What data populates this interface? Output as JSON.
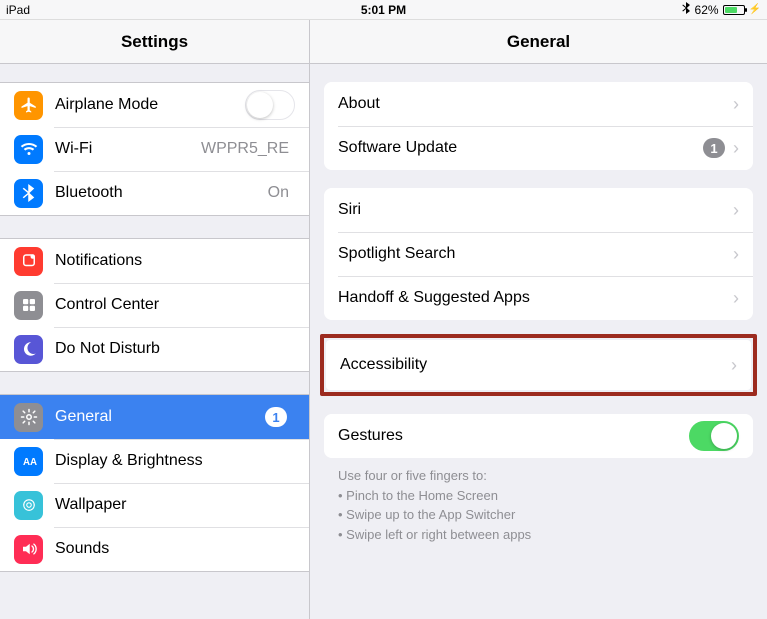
{
  "statusbar": {
    "device": "iPad",
    "time": "5:01 PM",
    "battery": "62%"
  },
  "sidebar": {
    "title": "Settings",
    "groups": [
      [
        {
          "key": "airplane",
          "label": "Airplane Mode",
          "toggle": "off"
        },
        {
          "key": "wifi",
          "label": "Wi-Fi",
          "value": "WPPR5_RE"
        },
        {
          "key": "bluetooth",
          "label": "Bluetooth",
          "value": "On"
        }
      ],
      [
        {
          "key": "notifications",
          "label": "Notifications"
        },
        {
          "key": "controlcenter",
          "label": "Control Center"
        },
        {
          "key": "dnd",
          "label": "Do Not Disturb"
        }
      ],
      [
        {
          "key": "general",
          "label": "General",
          "badge": "1",
          "selected": true
        },
        {
          "key": "display",
          "label": "Display & Brightness"
        },
        {
          "key": "wallpaper",
          "label": "Wallpaper"
        },
        {
          "key": "sounds",
          "label": "Sounds"
        }
      ]
    ]
  },
  "detail": {
    "title": "General",
    "groups": {
      "g1": [
        {
          "label": "About"
        },
        {
          "label": "Software Update",
          "badge": "1"
        }
      ],
      "g2": [
        {
          "label": "Siri"
        },
        {
          "label": "Spotlight Search"
        },
        {
          "label": "Handoff & Suggested Apps"
        }
      ],
      "accessibility": {
        "label": "Accessibility"
      },
      "g4": [
        {
          "label": "Gestures",
          "toggle": "on"
        }
      ],
      "footer": {
        "intro": "Use four or five fingers to:",
        "b1": "Pinch to the Home Screen",
        "b2": "Swipe up to the App Switcher",
        "b3": "Swipe left or right between apps"
      }
    }
  }
}
